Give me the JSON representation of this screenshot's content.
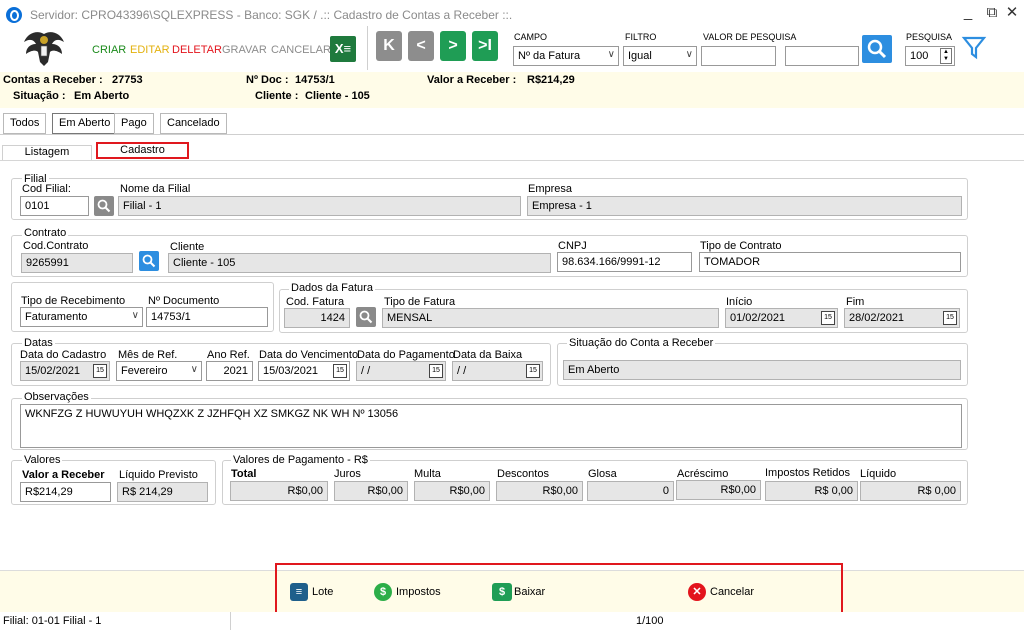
{
  "window": {
    "title": "Servidor: CPRO43396\\SQLEXPRESS - Banco: SGK / .:: Cadastro de Contas a Receber ::.",
    "minimize": "_",
    "popout": "⧉",
    "close": "✕"
  },
  "toolbar": {
    "criar": "CRIAR",
    "editar": "EDITAR",
    "deletar": "DELETAR",
    "gravar": "GRAVAR",
    "cancelar": "CANCELAR",
    "excel_icon": "excel-icon",
    "nav": [
      "K",
      "<",
      ">",
      ">I"
    ]
  },
  "search": {
    "campo_label": "CAMPO",
    "campo_value": "Nº da Fatura",
    "filtro_label": "FILTRO",
    "filtro_value": "Igual",
    "valor_label": "VALOR DE PESQUISA",
    "valor_value": "",
    "pesquisa_label": "PESQUISA",
    "pesquisa_value": "100"
  },
  "info": {
    "contas_label": "Contas a Receber :",
    "contas_value": "27753",
    "situacao_label": "Situação :",
    "situacao_value": "Em Aberto",
    "ndoc_label": "Nº Doc :",
    "ndoc_value": "14753/1",
    "cliente_label": "Cliente :",
    "cliente_value": "Cliente - 105",
    "valor_label": "Valor a Receber :",
    "valor_value": "R$214,29"
  },
  "tabs": [
    "Todos",
    "Em Aberto",
    "Pago",
    "Cancelado"
  ],
  "subtabs": [
    "Listagem",
    "Cadastro"
  ],
  "filial": {
    "group": "Filial",
    "cod_label": "Cod Filial:",
    "cod_value": "0101",
    "nome_label": "Nome da Filial",
    "nome_value": "Filial - 1",
    "empresa_label": "Empresa",
    "empresa_value": "Empresa - 1"
  },
  "contrato": {
    "group": "Contrato",
    "cod_label": "Cod.Contrato",
    "cod_value": "9265991",
    "cliente_label": "Cliente",
    "cliente_value": "Cliente - 105",
    "cnpj_label": "CNPJ",
    "cnpj_value": "98.634.166/9991-12",
    "tipo_label": "Tipo de Contrato",
    "tipo_value": "TOMADOR"
  },
  "recebimento": {
    "tipo_label": "Tipo de Recebimento",
    "tipo_value": "Faturamento",
    "ndoc_label": "Nº Documento",
    "ndoc_value": "14753/1"
  },
  "fatura": {
    "group": "Dados da Fatura",
    "cod_label": "Cod. Fatura",
    "cod_value": "1424",
    "tipo_label": "Tipo de Fatura",
    "tipo_value": "MENSAL",
    "inicio_label": "Início",
    "inicio_value": "01/02/2021",
    "fim_label": "Fim",
    "fim_value": "28/02/2021"
  },
  "datas": {
    "group": "Datas",
    "cadastro_label": "Data do Cadastro",
    "cadastro_value": "15/02/2021",
    "mes_label": "Mês de Ref.",
    "mes_value": "Fevereiro",
    "ano_label": "Ano Ref.",
    "ano_value": "2021",
    "venc_label": "Data do Vencimento",
    "venc_value": "15/03/2021",
    "pag_label": "Data do Pagamento",
    "pag_value": "/ /",
    "baixa_label": "Data da Baixa",
    "baixa_value": "/ /"
  },
  "situacao": {
    "group": "Situação do Conta a Receber",
    "value": "Em Aberto"
  },
  "observacoes": {
    "group": "Observações",
    "value": "WKNFZG Z HUWUYUH WHQZXK Z JZHFQH XZ SMKGZ NK WH Nº 13056"
  },
  "valores": {
    "group": "Valores",
    "receber_label": "Valor a Receber",
    "receber_value": "R$214,29",
    "liquido_label": "Líquido Previsto",
    "liquido_value": "R$ 214,29"
  },
  "pagamento": {
    "group": "Valores de Pagamento - R$",
    "total_label": "Total",
    "total_value": "R$0,00",
    "juros_label": "Juros",
    "juros_value": "R$0,00",
    "multa_label": "Multa",
    "multa_value": "R$0,00",
    "descontos_label": "Descontos",
    "descontos_value": "R$0,00",
    "glosa_label": "Glosa",
    "glosa_value": "0",
    "acrescimo_label": "Acréscimo",
    "acrescimo_value": "R$0,00",
    "impostos_label": "Impostos Retidos",
    "impostos_value": "R$ 0,00",
    "liquido_label": "Líquido",
    "liquido_value": "R$ 0,00"
  },
  "actions": {
    "lote": "Lote",
    "impostos": "Impostos",
    "baixar": "Baixar",
    "cancelar": "Cancelar"
  },
  "status": {
    "filial": "Filial: 01-01 Filial - 1",
    "pagina": "1/100"
  },
  "colors": {
    "criar": "#1a8a1a",
    "editar": "#e3b10d",
    "deletar": "#e3141c",
    "gravar": "#8c8c8c",
    "nav_green": "#1f9d55",
    "highlight": "#e0181e"
  }
}
